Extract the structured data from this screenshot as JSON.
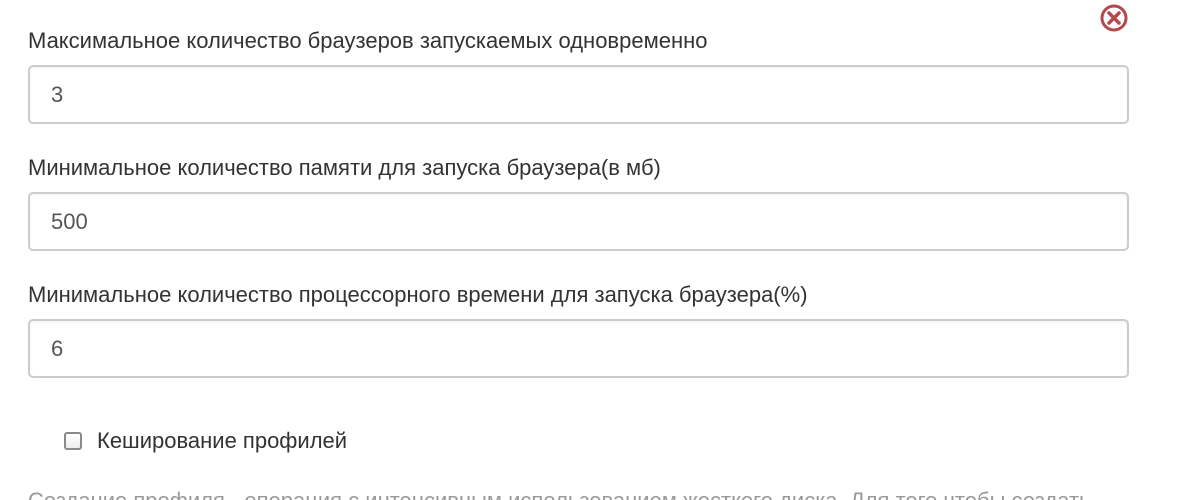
{
  "colors": {
    "close_icon": "#b5484a",
    "label_text": "#333333",
    "input_border": "#cccccc",
    "help_text": "#999999"
  },
  "close_button": {
    "icon": "close-circle-icon"
  },
  "fields": [
    {
      "label": "Максимальное количество браузеров запускаемых одновременно",
      "value": "3"
    },
    {
      "label": "Минимальное количество памяти для запуска браузера(в мб)",
      "value": "500"
    },
    {
      "label": "Минимальное количество процессорного времени для запуска браузера(%)",
      "value": "6"
    }
  ],
  "profile_cache": {
    "label": "Кеширование профилей",
    "checked": false
  },
  "help_text": "Создание профиля - операция с интенсивным использованием жесткого диска. Для того чтобы создать"
}
